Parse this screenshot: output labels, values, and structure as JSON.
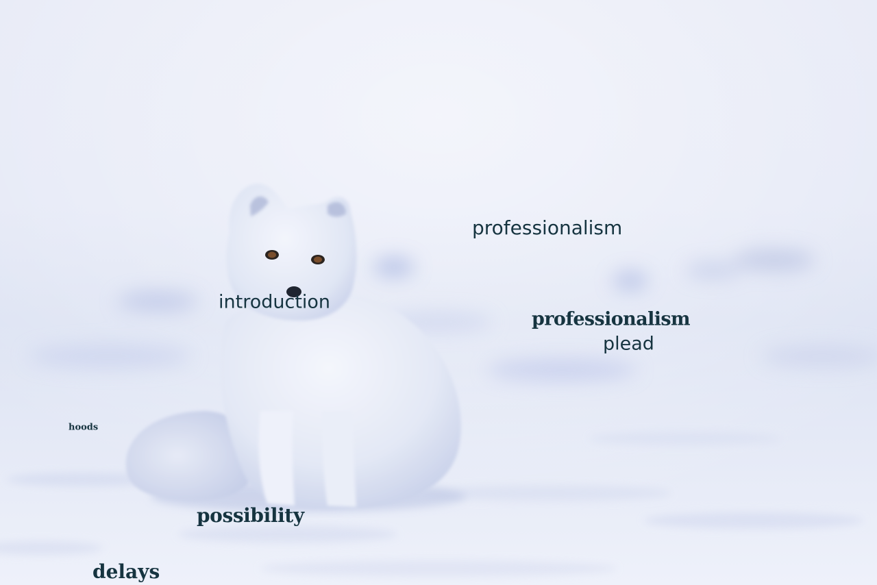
{
  "image": {
    "subject": "arctic-fox",
    "palette": {
      "sky": "#e3e7f5",
      "snow_light": "#f2f4fb",
      "snow_shadow": "#c9d2ec",
      "fur": "#eef1fa",
      "fur_shadow": "#c6cfe8",
      "eye": "#5a3a22",
      "nose": "#1f2530",
      "text": "#163440"
    }
  },
  "overlay_words": {
    "professionalism_top": "professionalism",
    "introduction": "introduction",
    "professionalism_bold": "professionalism",
    "plead": "plead",
    "hoods": "hoods",
    "possibility": "possibility",
    "delays": "delays"
  }
}
